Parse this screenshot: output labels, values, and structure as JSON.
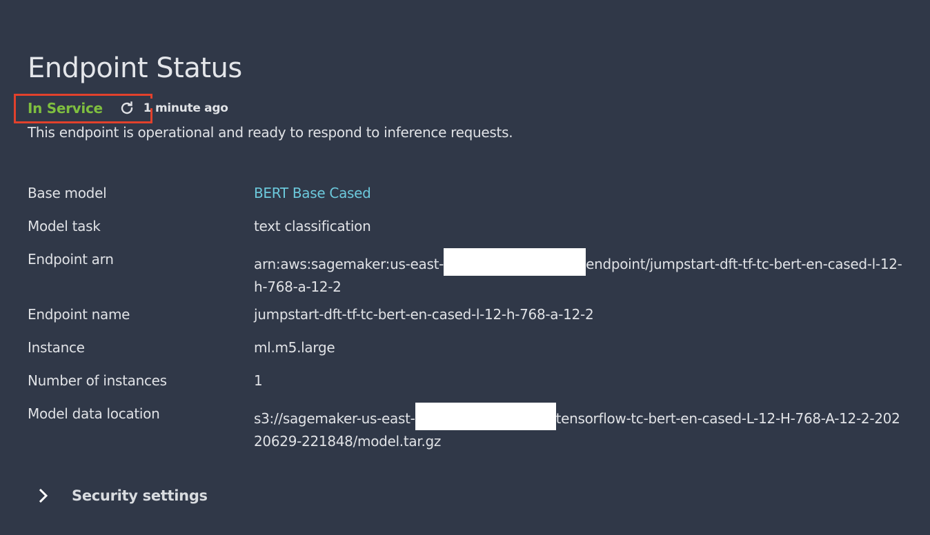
{
  "header": {
    "title": "Endpoint Status"
  },
  "status": {
    "state": "In Service",
    "state_color": "#7fbf3f",
    "refresh_icon": "refresh-icon",
    "updated": "1 minute ago",
    "description": "This endpoint is operational and ready to respond to inference requests."
  },
  "details": [
    {
      "label": "Base model",
      "value": "BERT Base Cased",
      "link": true
    },
    {
      "label": "Model task",
      "value": "text classification"
    },
    {
      "label": "Endpoint arn",
      "value_prefix": "arn:aws:sagemaker:us-east-",
      "value_suffix": "endpoint/jumpstart-dft-tf-tc-bert-en-cased-l-12-h-768-a-12-2",
      "redacted": true
    },
    {
      "label": "Endpoint name",
      "value": "jumpstart-dft-tf-tc-bert-en-cased-l-12-h-768-a-12-2"
    },
    {
      "label": "Instance",
      "value": "ml.m5.large"
    },
    {
      "label": "Number of instances",
      "value": "1"
    },
    {
      "label": "Model data location",
      "value_prefix": "s3://sagemaker-us-east-",
      "value_suffix": "tensorflow-tc-bert-en-cased-L-12-H-768-A-12-2-20220629-221848/model.tar.gz",
      "redacted": true
    }
  ],
  "security": {
    "label": "Security settings",
    "icon": "chevron-right-icon"
  },
  "colors": {
    "background": "#303848",
    "link": "#6cc9dc",
    "highlight": "#e2412c"
  }
}
